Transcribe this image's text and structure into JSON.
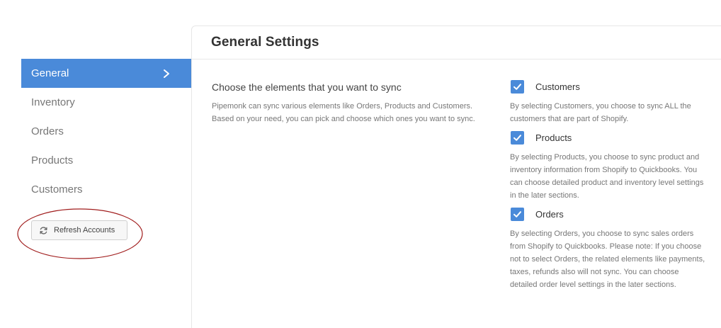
{
  "sidebar": {
    "items": [
      {
        "label": "General",
        "active": true
      },
      {
        "label": "Inventory",
        "active": false
      },
      {
        "label": "Orders",
        "active": false
      },
      {
        "label": "Products",
        "active": false
      },
      {
        "label": "Customers",
        "active": false
      }
    ],
    "refresh_button_label": "Refresh Accounts",
    "accent_color": "#4a8ad9",
    "annotation_color": "#a01c1c"
  },
  "panel": {
    "title": "General Settings",
    "section": {
      "heading": "Choose the elements that you want to sync",
      "description": "Pipemonk can sync various elements like Orders, Products and Customers. Based on your need, you can pick and choose which ones you want to sync."
    },
    "options": [
      {
        "label": "Customers",
        "checked": true,
        "description": "By selecting Customers, you choose to sync ALL the customers that are part of Shopify."
      },
      {
        "label": "Products",
        "checked": true,
        "description": "By selecting Products, you choose to sync product and inventory information from Shopify to Quickbooks. You can choose detailed product and inventory level settings in the later sections."
      },
      {
        "label": "Orders",
        "checked": true,
        "description": "By selecting Orders, you choose to sync sales orders from Shopify to Quickbooks. Please note: If you choose not to select Orders, the related elements like payments, taxes, refunds also will not sync. You can choose detailed order level settings in the later sections."
      }
    ]
  }
}
